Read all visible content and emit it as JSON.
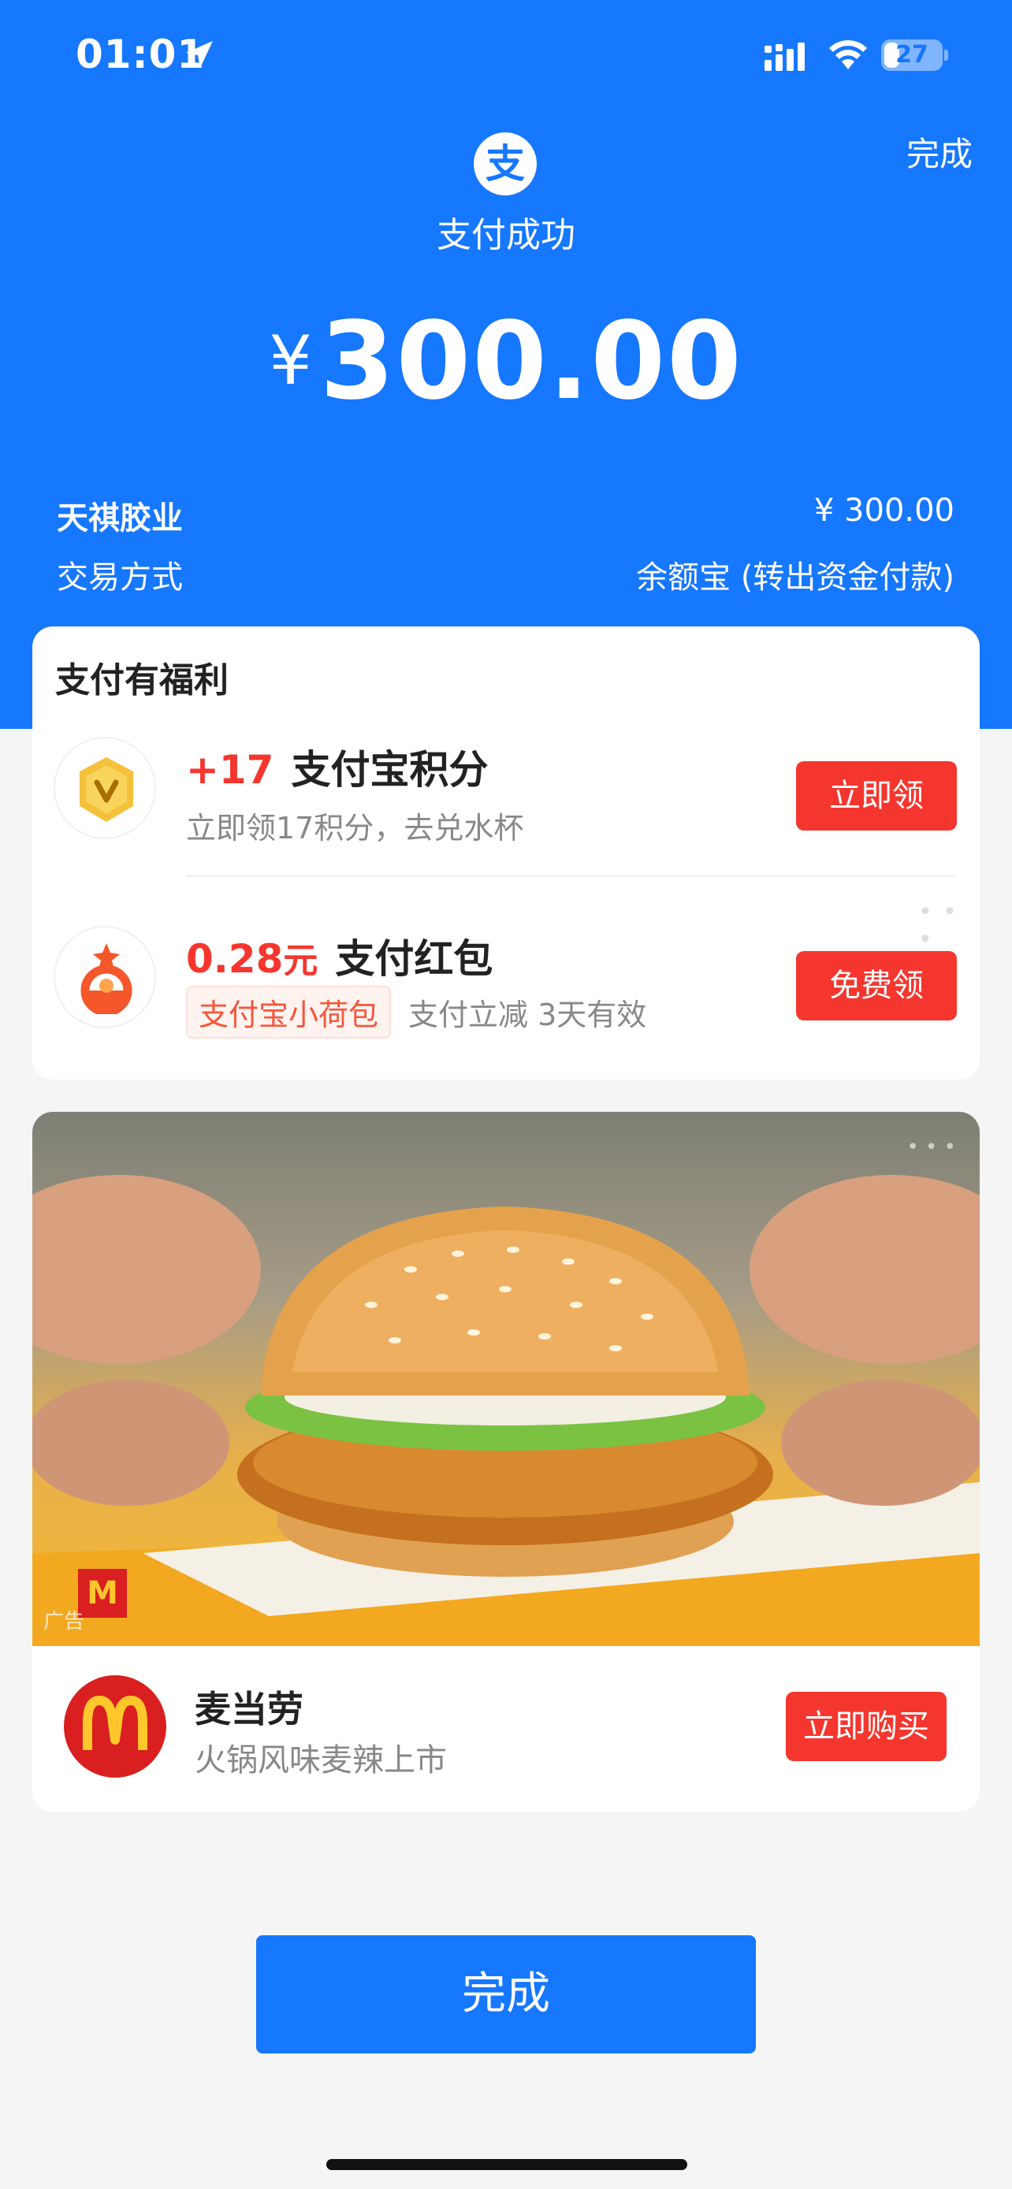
{
  "status_bar": {
    "time": "01:01",
    "battery": "27",
    "battery_level": 0.27
  },
  "header": {
    "done_label": "完成",
    "logo_glyph": "支",
    "status_text": "支付成功",
    "currency_symbol": "¥",
    "amount": "300.00",
    "merchant_name": "天祺胶业",
    "merchant_amount": "¥ 300.00",
    "method_label": "交易方式",
    "method_value": "余额宝 (转出资金付款)"
  },
  "benefits": {
    "title": "支付有福利",
    "items": [
      {
        "highlight": "+17",
        "title": "支付宝积分",
        "subtitle": "立即领17积分，去兑水杯",
        "button": "立即领"
      },
      {
        "highlight": "0.28",
        "unit": "元",
        "title": "支付红包",
        "tag": "支付宝小荷包",
        "subtitle": "支付立减 3天有效",
        "button": "免费领"
      }
    ]
  },
  "ad": {
    "ad_label": "广告",
    "brand_name": "麦当劳",
    "brand_subtitle": "火锅风味麦辣上市",
    "button": "立即购买",
    "mc_glyph": "M"
  },
  "footer": {
    "done_button": "完成"
  },
  "colors": {
    "primary_blue": "#1677ff",
    "button_red": "#f5362f",
    "background": "#f5f5f5"
  }
}
